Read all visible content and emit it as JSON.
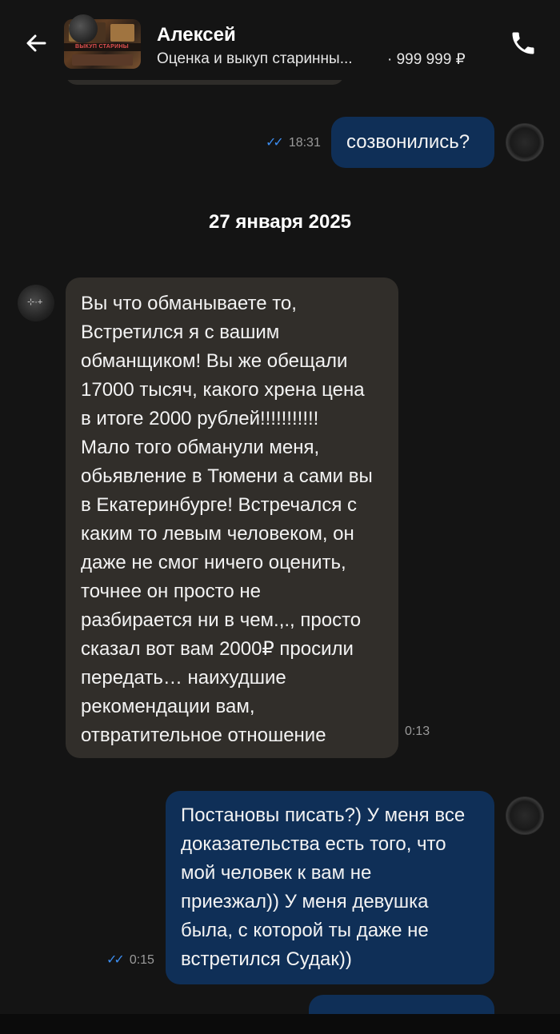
{
  "header": {
    "seller_name": "Алексей",
    "listing_title": "Оценка и выкуп старинны...",
    "listing_price": "· 999 999 ₽",
    "thumb_text": "ВЫКУП СТАРИНЫ"
  },
  "messages": [
    {
      "id": "m1",
      "direction": "out",
      "text": "созвонились?",
      "time": "18:31",
      "read": true
    },
    {
      "id": "m2",
      "direction": "in",
      "text": "Вы что обманываете то,\nВстретился я с вашим\nобманщиком! Вы же обещали\n17000 тысяч, какого хрена цена\nв итоге 2000 рублей!!!!!!!!!!!\nМало того обманули меня,\nобьявление в Тюмени а сами вы\nв Екатеринбурге! Встречался с\nкаким то левым человеком, он\nдаже не смог ничего оценить,\nточнее он просто не\nразбирается ни в чем.,., просто\nсказал вот вам 2000₽ просили\nпередать… наихудшие\nрекомендации вам,\nотвратительное отношение",
      "time": "0:13"
    },
    {
      "id": "m3",
      "direction": "out",
      "text": "Постановы писать?) У меня все\nдоказательства есть того, что\nмой человек к вам не\nприезжал)) У меня девушка\nбыла, с которой ты даже не\nвстретился Судак))",
      "time": "0:15",
      "read": true
    }
  ],
  "date_separator": "27 января 2025",
  "icons": {
    "back": "arrow-left-icon",
    "call": "phone-icon",
    "read": "double-check-icon"
  },
  "colors": {
    "background": "#141414",
    "incoming_bubble": "#312e2a",
    "outgoing_bubble": "#0f2f57",
    "read_ticks": "#3c8df0"
  }
}
